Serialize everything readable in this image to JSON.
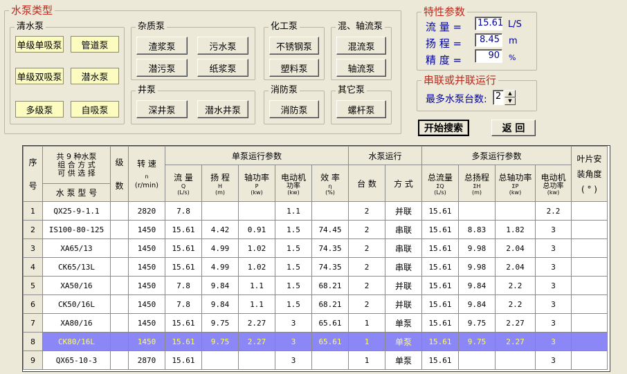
{
  "pump_types": {
    "title": "水泵类型",
    "clear": {
      "title": "清水泵",
      "buttons": [
        "单级单吸泵",
        "管道泵",
        "单级双吸泵",
        "潜水泵",
        "多级泵",
        "自吸泵"
      ]
    },
    "impurity": {
      "title": "杂质泵",
      "buttons": [
        "渣浆泵",
        "污水泵",
        "潜污泵",
        "纸浆泵"
      ]
    },
    "chemical": {
      "title": "化工泵",
      "buttons": [
        "不锈钢泵",
        "塑料泵"
      ]
    },
    "mixed": {
      "title": "混、轴流泵",
      "buttons": [
        "混流泵",
        "轴流泵"
      ]
    },
    "well": {
      "title": "井泵",
      "buttons": [
        "深井泵",
        "潜水井泵"
      ]
    },
    "fire": {
      "title": "消防泵",
      "buttons": [
        "消防泵"
      ]
    },
    "other": {
      "title": "其它泵",
      "buttons": [
        "螺杆泵"
      ]
    }
  },
  "params": {
    "title": "特性参数",
    "flow": {
      "label": "流  量 =",
      "value": "15.61",
      "unit": "L/S"
    },
    "head": {
      "label": "扬  程 =",
      "value": "8.45",
      "unit": "m"
    },
    "precision": {
      "label": "精  度 =",
      "value": "90",
      "unit": "%"
    }
  },
  "series": {
    "title": "串联或并联运行",
    "label": "最多水泵台数:",
    "value": "2"
  },
  "actions": {
    "search": "开始搜索",
    "back": "返  回"
  },
  "table": {
    "header": {
      "seq_top": "序",
      "seq_bottom": "号",
      "combo_line1": "共 9 种水泵",
      "combo_line2": "组 合 方 式",
      "combo_line3": "可 供 选 择",
      "model": "水 泵 型 号",
      "stage_top": "级",
      "stage_bottom": "数",
      "speed_top": "转  速",
      "speed_sym": "n",
      "speed_unit": "(r/min)",
      "single_group": "单泵运行参数",
      "flow": "流  量",
      "flow_sym": "Q",
      "flow_unit": "(L/s)",
      "head": "扬  程",
      "head_sym": "H",
      "head_unit": "(m)",
      "shaft": "轴功率",
      "shaft_sym": "P",
      "shaft_unit": "(kw)",
      "motor": "电动机",
      "motor_2": "功率",
      "motor_unit": "(kw)",
      "eff": "效  率",
      "eff_sym": "η",
      "eff_unit": "(%)",
      "run_group": "水泵运行",
      "count": "台  数",
      "mode": "方  式",
      "multi_group": "多泵运行参数",
      "tflow": "总流量",
      "tflow_sym": "ΣQ",
      "tflow_unit": "(L/s)",
      "thead": "总扬程",
      "thead_sym": "ΣH",
      "thead_unit": "(m)",
      "tshaft": "总轴功率",
      "tshaft_sym": "ΣP",
      "tshaft_unit": "(kw)",
      "tmotor": "电动机",
      "tmotor_2": "总功率",
      "tmotor_unit": "(kw)",
      "blade_top": "叶片安",
      "blade_mid": "装角度",
      "blade_bottom": "( ° )"
    },
    "rows": [
      [
        "1",
        "QX25-9-1.1",
        "",
        "2820",
        "7.8",
        "",
        "",
        "1.1",
        "",
        "2",
        "并联",
        "15.61",
        "",
        "",
        "2.2",
        ""
      ],
      [
        "2",
        "IS100-80-125",
        "",
        "1450",
        "15.61",
        "4.42",
        "0.91",
        "1.5",
        "74.45",
        "2",
        "串联",
        "15.61",
        "8.83",
        "1.82",
        "3",
        ""
      ],
      [
        "3",
        "XA65/13",
        "",
        "1450",
        "15.61",
        "4.99",
        "1.02",
        "1.5",
        "74.35",
        "2",
        "串联",
        "15.61",
        "9.98",
        "2.04",
        "3",
        ""
      ],
      [
        "4",
        "CK65/13L",
        "",
        "1450",
        "15.61",
        "4.99",
        "1.02",
        "1.5",
        "74.35",
        "2",
        "串联",
        "15.61",
        "9.98",
        "2.04",
        "3",
        ""
      ],
      [
        "5",
        "XA50/16",
        "",
        "1450",
        "7.8",
        "9.84",
        "1.1",
        "1.5",
        "68.21",
        "2",
        "并联",
        "15.61",
        "9.84",
        "2.2",
        "3",
        ""
      ],
      [
        "6",
        "CK50/16L",
        "",
        "1450",
        "7.8",
        "9.84",
        "1.1",
        "1.5",
        "68.21",
        "2",
        "并联",
        "15.61",
        "9.84",
        "2.2",
        "3",
        ""
      ],
      [
        "7",
        "XA80/16",
        "",
        "1450",
        "15.61",
        "9.75",
        "2.27",
        "3",
        "65.61",
        "1",
        "单泵",
        "15.61",
        "9.75",
        "2.27",
        "3",
        ""
      ],
      [
        "8",
        "CK80/16L",
        "",
        "1450",
        "15.61",
        "9.75",
        "2.27",
        "3",
        "65.61",
        "1",
        "单泵",
        "15.61",
        "9.75",
        "2.27",
        "3",
        ""
      ],
      [
        "9",
        "QX65-10-3",
        "",
        "2870",
        "15.61",
        "",
        "",
        "3",
        "",
        "1",
        "单泵",
        "15.61",
        "",
        "",
        "3",
        ""
      ]
    ],
    "highlight_row": 8,
    "highlight_color": "#8b87f6",
    "highlight_text_color": "#ffff5a"
  },
  "colors": {
    "title_red": "#c0281c",
    "label_navy": "#0000a0",
    "button_yellow": "#fdfcc0"
  }
}
